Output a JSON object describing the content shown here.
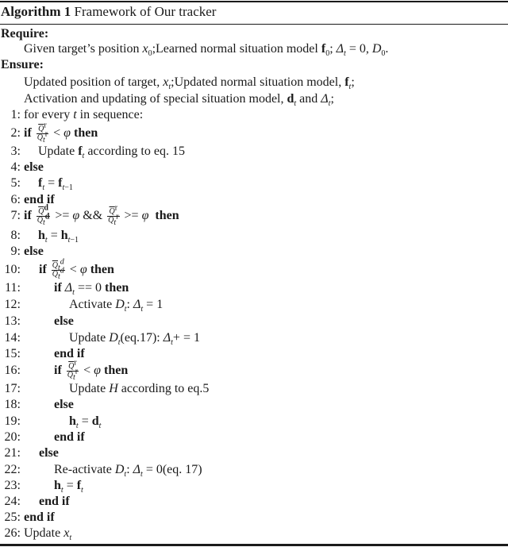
{
  "caption": {
    "label": "Algorithm 1",
    "title": "Framework of Our tracker"
  },
  "require": {
    "heading": "Require:",
    "text": "Given target’s position x0;Learned normal situation model f0; Δt = 0, D0."
  },
  "ensure": {
    "heading": "Ensure:",
    "lines": [
      "Updated position of target, xt;Updated normal situation model, ft;",
      "Activation and updating of special situation model, dt and Δt;"
    ]
  },
  "steps": [
    {
      "n": "1:",
      "text": "for every t in sequence:"
    },
    {
      "n": "2:",
      "text": "if Q̄r/Qtr < φ then"
    },
    {
      "n": "3:",
      "text": "Update ft according to eq. 15"
    },
    {
      "n": "4:",
      "text": "else"
    },
    {
      "n": "5:",
      "text": "ft = ft−1"
    },
    {
      "n": "6:",
      "text": "end if"
    },
    {
      "n": "7:",
      "text": "if Q̄d/Qtd >= φ && Q̄r/Qtr >= φ then"
    },
    {
      "n": "8:",
      "text": "ht = ht−1"
    },
    {
      "n": "9:",
      "text": "else"
    },
    {
      "n": "10:",
      "text": "if Q̄td/Qtd < φ then"
    },
    {
      "n": "11:",
      "text": "if Δt == 0 then"
    },
    {
      "n": "12:",
      "text": "Activate Dt: Δt = 1"
    },
    {
      "n": "13:",
      "text": "else"
    },
    {
      "n": "14:",
      "text": "Update Dt(eq.17): Δt+ = 1"
    },
    {
      "n": "15:",
      "text": "end if"
    },
    {
      "n": "16:",
      "text": "if Q̄r/Qtr < φ then"
    },
    {
      "n": "17:",
      "text": "Update H according to eq.5"
    },
    {
      "n": "18:",
      "text": "else"
    },
    {
      "n": "19:",
      "text": "ht = dt"
    },
    {
      "n": "20:",
      "text": "end if"
    },
    {
      "n": "21:",
      "text": "else"
    },
    {
      "n": "22:",
      "text": "Re-activate Dt: Δt = 0(eq. 17)"
    },
    {
      "n": "23:",
      "text": "ht = ft"
    },
    {
      "n": "24:",
      "text": "end if"
    },
    {
      "n": "25:",
      "text": "end if"
    },
    {
      "n": "26:",
      "text": "Update xt"
    }
  ],
  "tokens": {
    "for": "for",
    "every": "every",
    "in_sequence": "in sequence:",
    "if": "if",
    "then": "then",
    "else": "else",
    "end_if": "end if",
    "update": "Update",
    "activate": "Activate",
    "reactivate": "Re-activate",
    "according_eq15": "according to eq. 15",
    "according_eq5": "according to eq.5",
    "eq17": "(eq.17):",
    "eq17b": "(eq. 17)",
    "t": "t",
    "f": "f",
    "h": "h",
    "d": "d",
    "x": "x",
    "D": "D",
    "H": "H",
    "Q": "Q",
    "delta": "Δ",
    "phi": "φ",
    "r": "r",
    "dsup": "d",
    "lt": "<",
    "ge": ">=",
    "eq": "=",
    "eqeq": "==",
    "pluseq": "+ =",
    "and": "&&",
    "zero": "0",
    "one": "1",
    "tminus1": "t−1",
    "colon": ":"
  }
}
